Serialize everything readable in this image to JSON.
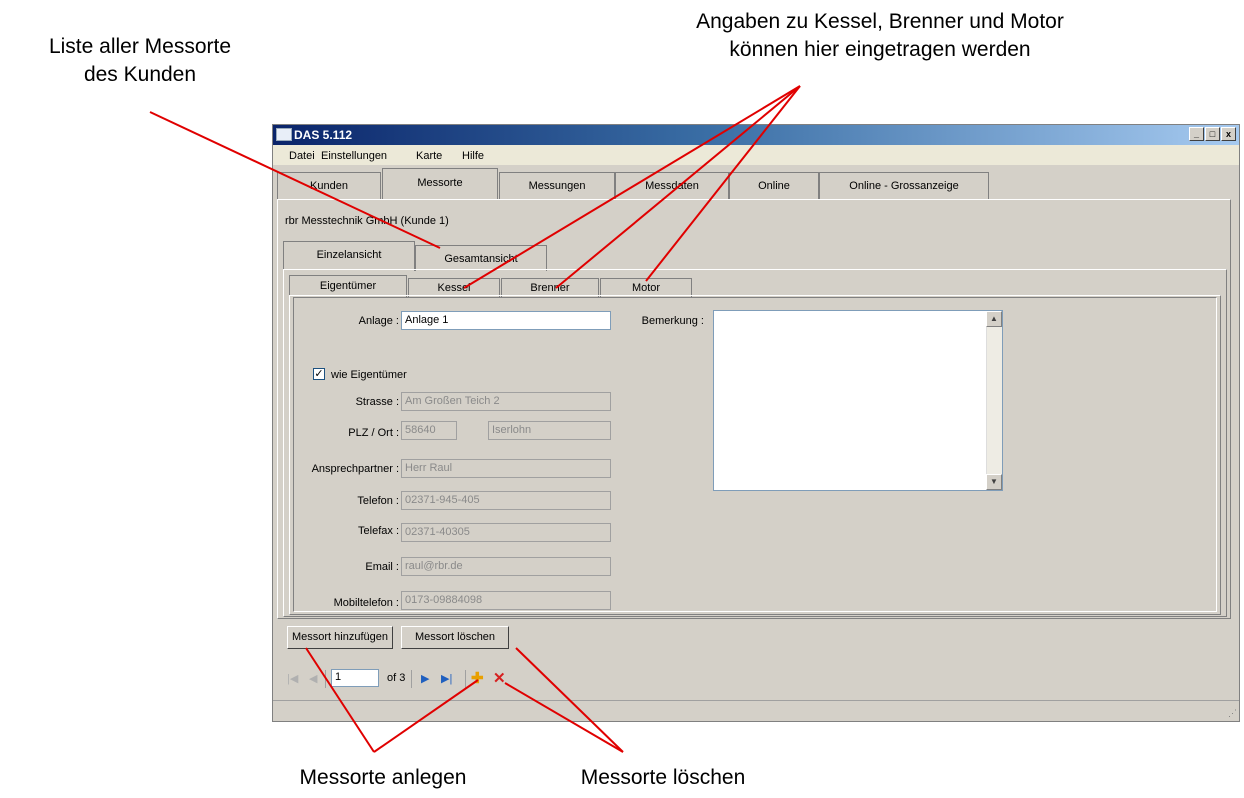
{
  "annotations": {
    "top_left": [
      "Liste aller Messorte",
      "des Kunden"
    ],
    "top_right": [
      "Angaben zu Kessel, Brenner und Motor",
      "können hier eingetragen werden"
    ],
    "bottom_left": "Messorte anlegen",
    "bottom_right": "Messorte löschen"
  },
  "window": {
    "title": "DAS 5.112",
    "controls": {
      "minimize": "_",
      "maximize": "□",
      "close": "x"
    }
  },
  "menu": [
    "Datei",
    "Einstellungen",
    "Karte",
    "Hilfe"
  ],
  "main_tabs": [
    "Kunden",
    "Messorte",
    "Messungen",
    "Messdaten",
    "Online",
    "Online - Grossanzeige"
  ],
  "main_tabs_active": "Messorte",
  "customer": "rbr Messtechnik GmbH (Kunde 1)",
  "view_tabs": [
    "Einzelansicht",
    "Gesamtansicht"
  ],
  "sub_tabs": [
    "Eigentümer",
    "Kessel",
    "Brenner",
    "Motor"
  ],
  "form": {
    "anlage_label": "Anlage :",
    "anlage_value": "Anlage 1",
    "bemerkung_label": "Bemerkung :",
    "checkbox_label": "wie Eigentümer",
    "checkbox_checked": true,
    "strasse_label": "Strasse :",
    "strasse_value": "Am Großen Teich 2",
    "plz_label": "PLZ / Ort :",
    "plz_value": "58640",
    "ort_value": "Iserlohn",
    "ansprech_label": "Ansprechpartner :",
    "ansprech_value": "Herr Raul",
    "telefon_label": "Telefon :",
    "telefon_value": "02371-945-405",
    "telefax_label": "Telefax :",
    "telefax_value": "02371-40305",
    "email_label": "Email :",
    "email_value": "raul@rbr.de",
    "mobil_label": "Mobiltelefon :",
    "mobil_value": "0173-09884098"
  },
  "buttons": {
    "add": "Messort hinzufügen",
    "delete": "Messort löschen"
  },
  "navigator": {
    "position": "1",
    "of_label": "of 3"
  },
  "colors": {
    "annotation_arrow": "#e00000",
    "window_bg": "#d4d0c8",
    "title_bar": "#0a246a"
  }
}
